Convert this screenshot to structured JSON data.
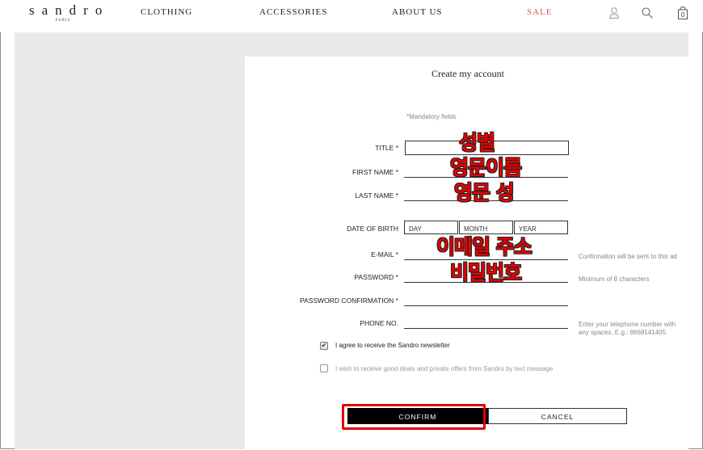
{
  "brand": {
    "name": "sandro",
    "sub": "PARIS"
  },
  "nav": {
    "items": [
      "CLOTHING",
      "ACCESSORIES",
      "ABOUT US",
      "SALE"
    ],
    "sale_color": "#e2574c"
  },
  "header_icons": [
    "user-icon",
    "search-icon",
    "bag-icon"
  ],
  "cart": {
    "count": "0"
  },
  "form": {
    "title": "Create my account",
    "mandatory": "*Mandatory fields",
    "fields": {
      "title": "TITLE *",
      "first_name": "FIRST NAME *",
      "last_name": "LAST NAME *",
      "dob": "DATE OF BIRTH",
      "email": "E-MAIL *",
      "password": "PASSWORD *",
      "password_confirm": "PASSWORD CONFIRMATION *",
      "phone": "PHONE NO."
    },
    "dob_parts": {
      "day": "DAY",
      "month": "MONTH",
      "year": "YEAR"
    },
    "hints": {
      "email": "Confirmation will be sent to this ad",
      "password": "Minimum of 8 characters",
      "phone_line1": "Enter your telephone number with",
      "phone_line2": "any spaces. E.g.: 8668141405"
    },
    "checkboxes": [
      {
        "label": "I agree to receive the Sandro newsletter",
        "checked": true
      },
      {
        "label": "I wish to receive good deals and private offers from Sandro by text message",
        "checked": false
      }
    ],
    "buttons": {
      "confirm": "CONFIRM",
      "cancel": "CANCEL"
    }
  },
  "annotations": {
    "title": "성별",
    "first_name": "영문이름",
    "last_name": "영문 성",
    "email": "이메일 주소",
    "password": "비밀번호",
    "color": "#e60000"
  }
}
